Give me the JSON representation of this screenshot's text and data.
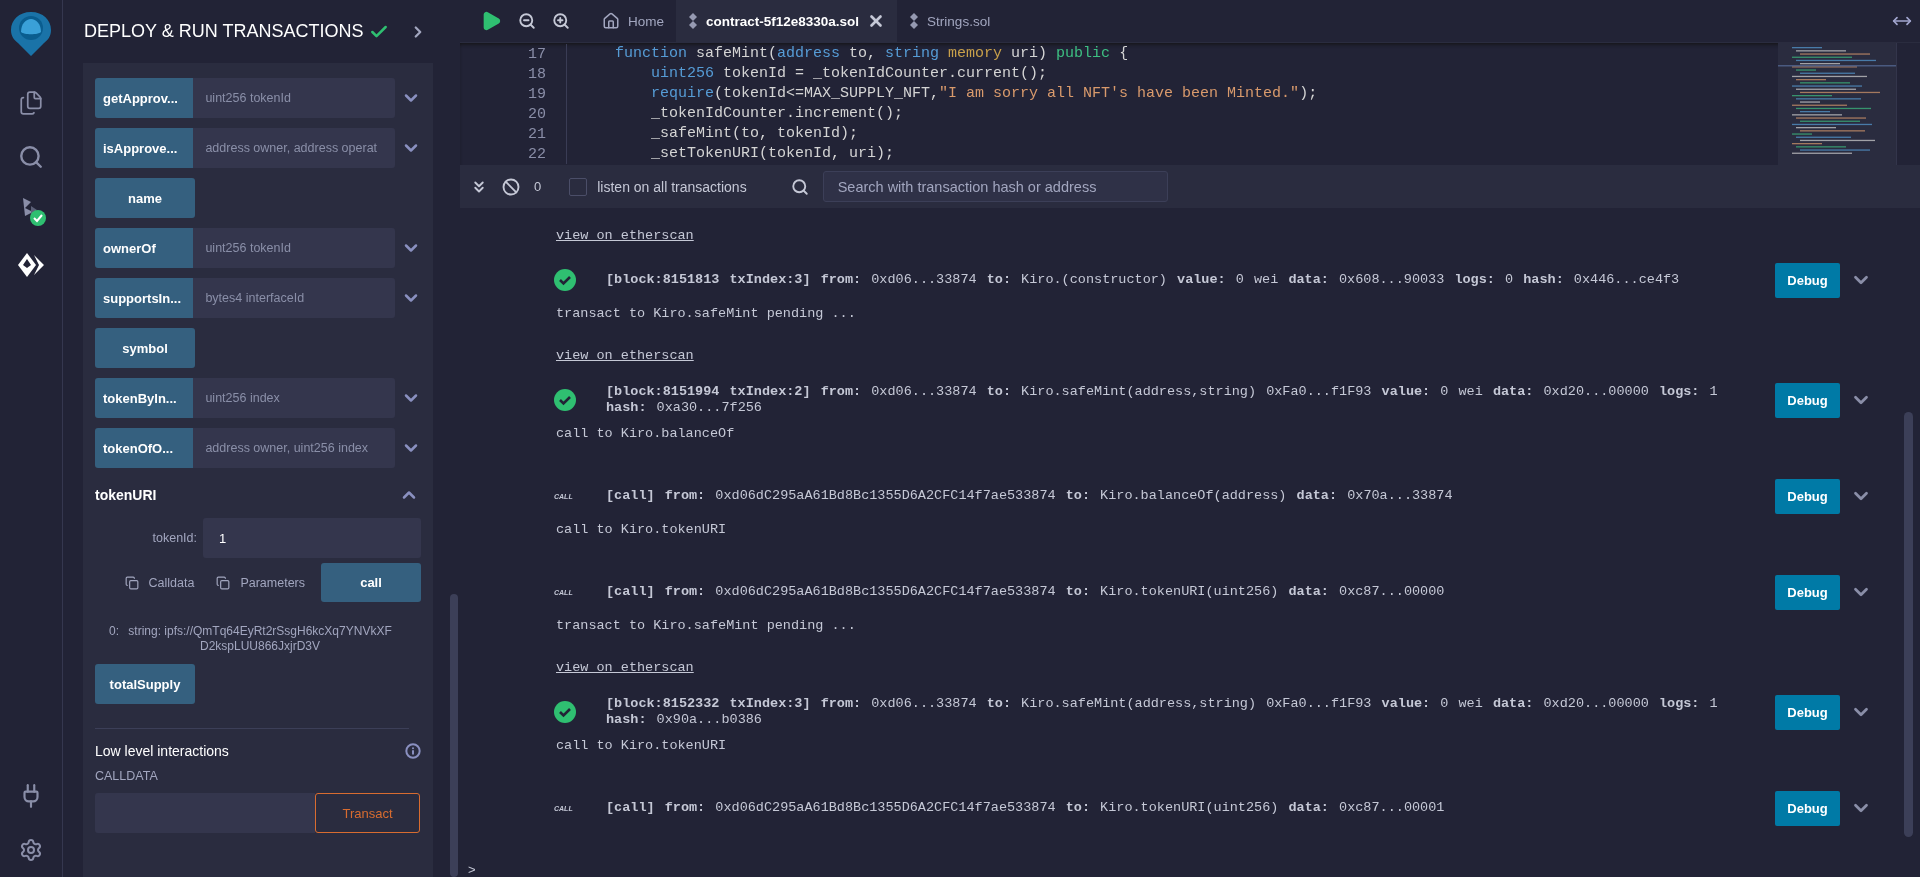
{
  "icon_bar": {
    "items": [
      {
        "kind": "files",
        "selected": false
      },
      {
        "kind": "search",
        "selected": false
      },
      {
        "kind": "compiler",
        "selected": false
      },
      {
        "kind": "deploy",
        "selected": true
      }
    ],
    "bottom": [
      {
        "kind": "plugin"
      },
      {
        "kind": "settings"
      }
    ]
  },
  "side_panel": {
    "title": "DEPLOY & RUN TRANSACTIONS",
    "functions": [
      {
        "kind": "input",
        "label": "getApprov...",
        "placeholder": "uint256 tokenId"
      },
      {
        "kind": "input",
        "label": "isApprove...",
        "placeholder": "address owner, address operat"
      },
      {
        "kind": "plain",
        "label": "name"
      },
      {
        "kind": "input",
        "label": "ownerOf",
        "placeholder": "uint256 tokenId"
      },
      {
        "kind": "input",
        "label": "supportsIn...",
        "placeholder": "bytes4 interfaceId"
      },
      {
        "kind": "plain",
        "label": "symbol"
      },
      {
        "kind": "input",
        "label": "tokenByIn...",
        "placeholder": "uint256 index"
      },
      {
        "kind": "input",
        "label": "tokenOfO...",
        "placeholder": "address owner, uint256 index"
      },
      {
        "kind": "expanded",
        "label": "tokenURI",
        "param_label": "tokenId:",
        "value": "1",
        "calldata": "Calldata",
        "parameters": "Parameters",
        "action": "call",
        "result_index": "0:",
        "result": "string: ipfs://QmTq64EyRt2rSsgH6kcXq7YNVkXFD2kspLUU866JxjrD3V"
      },
      {
        "kind": "plain",
        "label": "totalSupply"
      }
    ],
    "low_level": {
      "title": "Low level interactions",
      "field_label": "CALLDATA",
      "action": "Transact"
    }
  },
  "tabs": [
    {
      "kind": "home",
      "label": "Home",
      "selected": false
    },
    {
      "kind": "file",
      "label": "contract-5f12e8330a.sol",
      "selected": true
    },
    {
      "kind": "file",
      "label": "Strings.sol",
      "selected": false
    }
  ],
  "editor": {
    "lines": [
      {
        "number": "17",
        "kind": "signature",
        "tokens": [
          {
            "text": "function",
            "kind": "keyword"
          },
          {
            "text": "safeMint(",
            "kind": "plain",
            "glue": true
          },
          {
            "text": "address",
            "kind": "keyword"
          },
          {
            "text": "to,",
            "kind": "plain"
          },
          {
            "text": "string",
            "kind": "keyword"
          },
          {
            "text": "memory",
            "kind": "modifier"
          },
          {
            "text": "uri)",
            "kind": "plain"
          },
          {
            "text": "public",
            "kind": "visibility"
          },
          {
            "text": "{",
            "kind": "plain"
          }
        ]
      },
      {
        "number": "18",
        "kind": "statement",
        "tokens": [
          {
            "text": "uint256",
            "kind": "keyword"
          },
          {
            "text": "tokenId = _tokenIdCounter.current();",
            "kind": "plain"
          }
        ]
      },
      {
        "number": "19",
        "kind": "statement",
        "tokens": [
          {
            "text": "require",
            "kind": "keyword",
            "glue": true
          },
          {
            "text": "(tokenId<=MAX_SUPPLY_NFT,",
            "kind": "plain",
            "glue": true
          },
          {
            "text": "\"I am sorry all NFT's have been Minted.\"",
            "kind": "string",
            "glue": true
          },
          {
            "text": ");",
            "kind": "plain"
          }
        ]
      },
      {
        "number": "20",
        "kind": "statement",
        "tokens": [
          {
            "text": "_tokenIdCounter.increment();",
            "kind": "plain"
          }
        ]
      },
      {
        "number": "21",
        "kind": "statement",
        "tokens": [
          {
            "text": "_safeMint(to, tokenId);",
            "kind": "plain"
          }
        ]
      },
      {
        "number": "22",
        "kind": "statement",
        "tokens": [
          {
            "text": "_setTokenURI(tokenId, uri);",
            "kind": "plain"
          }
        ]
      }
    ]
  },
  "terminal": {
    "pending_count": "0",
    "listen_label": "listen on all transactions",
    "listen_checked": false,
    "search_placeholder": "Search with transaction hash or address",
    "log": [
      {
        "kind": "link",
        "text": "view on etherscan"
      },
      {
        "kind": "tx",
        "text": "**[block:8151813 txIndex:3]** **from:** 0xd06...33874 **to:** Kiro.(constructor) **value:** 0 wei **data:** 0x608...90033 **logs:** 0 **hash:** 0x446...ce4f3",
        "action": "Debug"
      },
      {
        "kind": "note",
        "text": "transact to Kiro.safeMint pending ..."
      },
      {
        "kind": "link",
        "text": "view on etherscan"
      },
      {
        "kind": "tx",
        "text": "**[block:8151994 txIndex:2]** **from:** 0xd06...33874 **to:** Kiro.safeMint(address,string) 0xFa0...f1F93 **value:** 0 wei **data:** 0xd20...00000 **logs:** 1 **hash:** 0xa30...7f256",
        "action": "Debug"
      },
      {
        "kind": "note",
        "text": "call to Kiro.balanceOf"
      },
      {
        "kind": "call",
        "badge": "CALL",
        "text": "**[call]** **from:** 0xd06dC295aA61Bd8Bc1355D6A2CFC14f7ae533874 **to:** Kiro.balanceOf(address) **data:** 0x70a...33874",
        "action": "Debug"
      },
      {
        "kind": "note",
        "text": "call to Kiro.tokenURI"
      },
      {
        "kind": "call",
        "badge": "CALL",
        "text": "**[call]** **from:** 0xd06dC295aA61Bd8Bc1355D6A2CFC14f7ae533874 **to:** Kiro.tokenURI(uint256) **data:** 0xc87...00000",
        "action": "Debug"
      },
      {
        "kind": "note",
        "text": "transact to Kiro.safeMint pending ..."
      },
      {
        "kind": "link",
        "text": "view on etherscan"
      },
      {
        "kind": "tx",
        "text": "**[block:8152332 txIndex:3]** **from:** 0xd06...33874 **to:** Kiro.safeMint(address,string) 0xFa0...f1F93 **value:** 0 wei **data:** 0xd20...00000 **logs:** 1 **hash:** 0x90a...b0386",
        "action": "Debug"
      },
      {
        "kind": "note",
        "text": "call to Kiro.tokenURI"
      },
      {
        "kind": "call",
        "badge": "CALL",
        "text": "**[call]** **from:** 0xd06dC295aA61Bd8Bc1355D6A2CFC14f7ae533874 **to:** Kiro.tokenURI(uint256) **data:** 0xc87...00001",
        "action": "Debug"
      }
    ],
    "prompt": ">"
  }
}
